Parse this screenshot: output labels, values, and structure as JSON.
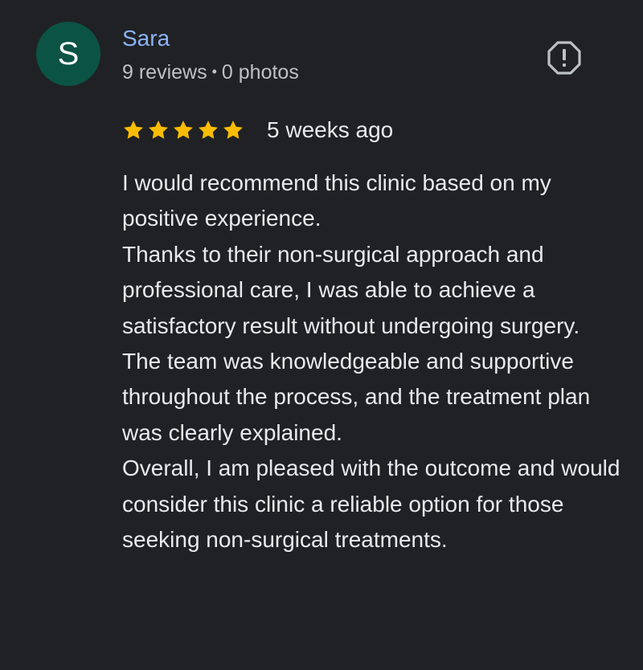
{
  "reviewer": {
    "initial": "S",
    "name": "Sara",
    "reviews_count": "9 reviews",
    "separator": "•",
    "photos_count": "0 photos",
    "avatar_color": "#0b5345"
  },
  "actions": {
    "report_icon": "report-flag-octagon-icon"
  },
  "rating": {
    "stars": 5,
    "max_stars": 5,
    "star_color": "#fbbc04",
    "date": "5 weeks ago"
  },
  "review": {
    "paragraphs": [
      "I would recommend this clinic based on my positive experience.",
      "Thanks to their non-surgical approach and professional care, I was able to achieve a satisfactory result without undergoing surgery.",
      "The team was knowledgeable and supportive throughout the process, and the treatment plan was clearly explained.",
      "Overall, I am pleased with the outcome and would consider this clinic a reliable option for those seeking non-surgical treatments."
    ]
  },
  "colors": {
    "background": "#202124",
    "name_link": "#8ab4f8",
    "text_primary": "#e8eaed",
    "text_secondary": "#bdc1c6"
  }
}
